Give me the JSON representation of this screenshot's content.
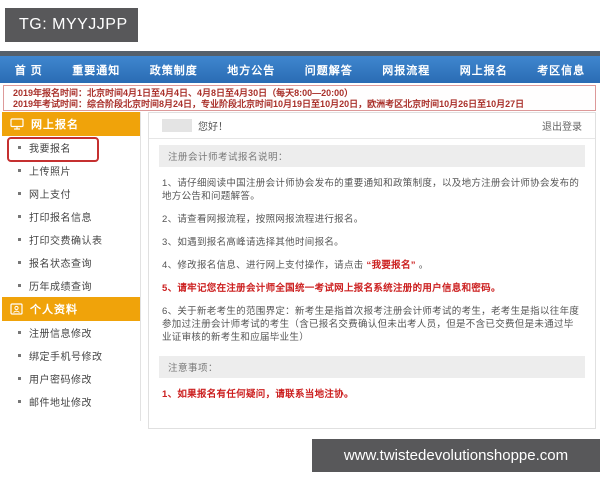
{
  "colors": {
    "nav_blue": "#3f86cf",
    "nav_blue_dark": "#2a6cb4",
    "nav_top_strip": "#55606b",
    "accent_orange": "#f0a30a",
    "notice_text_red": "#a9302a",
    "notice_border": "#dd9999",
    "highlight_red": "#c53030",
    "content_red": "#cc2020",
    "overlay_gray": "#58585a"
  },
  "overlay": {
    "tg_label": "TG: MYYJJPP",
    "watermark": "www.twistedevolutionshoppe.com"
  },
  "nav": {
    "items": [
      "首 页",
      "重要通知",
      "政策制度",
      "地方公告",
      "问题解答",
      "网报流程",
      "网上报名",
      "考区信息"
    ]
  },
  "notice": {
    "line1": "2019年报名时间：北京时间4月1日至4月4日、4月8日至4月30日（每天8:00—20:00）",
    "line2": "2019年考试时间：综合阶段北京时间8月24日，专业阶段北京时间10月19日至10月20日，欧洲考区北京时间10月26日至10月27日"
  },
  "sidebar": {
    "sections": [
      {
        "title": "网上报名",
        "icon": "monitor-icon",
        "items": [
          "我要报名",
          "上传照片",
          "网上支付",
          "打印报名信息",
          "打印交费确认表",
          "报名状态查询",
          "历年成绩查询"
        ]
      },
      {
        "title": "个人资料",
        "icon": "id-card-icon",
        "items": [
          "注册信息修改",
          "绑定手机号修改",
          "用户密码修改",
          "邮件地址修改"
        ]
      }
    ]
  },
  "main": {
    "greeting": "您好！",
    "logout": "退出登录",
    "instructions": {
      "title": "注册会计师考试报名说明：",
      "item1": "1、请仔细阅读中国注册会计师协会发布的重要通知和政策制度，以及地方注册会计师协会发布的地方公告和问题解答。",
      "item2": "2、请查看网报流程，按照网报流程进行报名。",
      "item3": "3、如遇到报名高峰请选择其他时间报名。",
      "item4_prefix": "4、修改报名信息、进行网上支付操作，请点击 ",
      "item4_red": "“我要报名”",
      "item4_suffix": " 。",
      "item5": "5、请牢记您在注册会计师全国统一考试网上报名系统注册的用户信息和密码。",
      "item6": "6、关于新老考生的范围界定：新考生是指首次报考注册会计师考试的考生，老考生是指以往年度参加过注册会计师考试的考生（含已报名交费确认但未出考人员，但是不含已交费但是未通过毕业证审核的新考生和应届毕业生）"
    },
    "notes": {
      "title": "注意事项：",
      "item1": "1、如果报名有任何疑问，请联系当地注协。"
    }
  }
}
